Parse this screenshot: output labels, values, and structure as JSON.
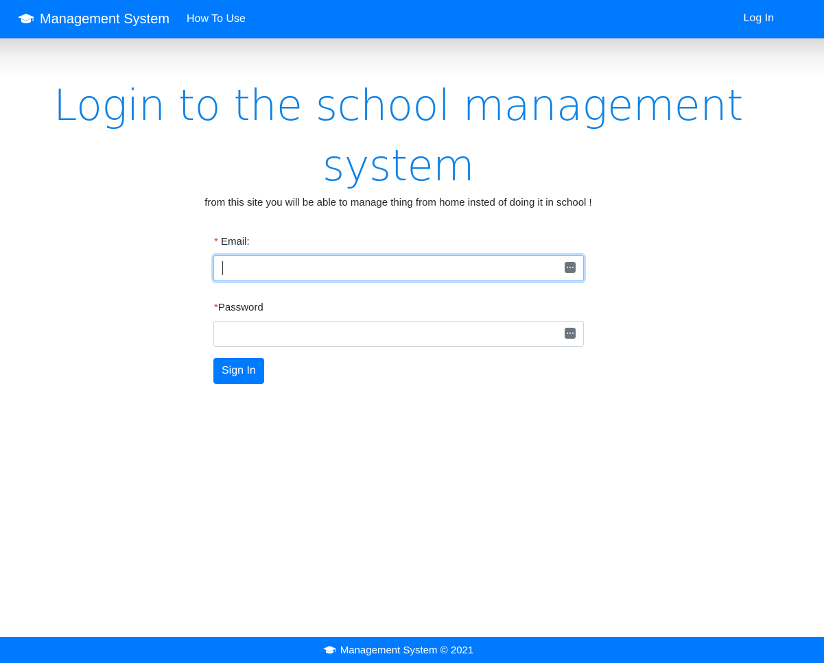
{
  "colors": {
    "primary": "#007bff",
    "title": "#0d82e6",
    "required": "#dc3545"
  },
  "navbar": {
    "brand_icon": "graduation-cap-icon",
    "brand": "Management System",
    "how_to_use": "How To Use",
    "login": "Log In"
  },
  "hero": {
    "title": "Login to the school management system",
    "subtitle": "from this site you will be able to manage thing from home insted of doing it in school !"
  },
  "form": {
    "email": {
      "required_mark": "*",
      "label": " Email:",
      "value": "",
      "icon": "password-manager-icon"
    },
    "password": {
      "required_mark": "*",
      "label": "Password",
      "value": "",
      "icon": "password-manager-icon"
    },
    "submit": "Sign In"
  },
  "footer": {
    "icon": "graduation-cap-icon",
    "text": "Management System © 2021"
  }
}
